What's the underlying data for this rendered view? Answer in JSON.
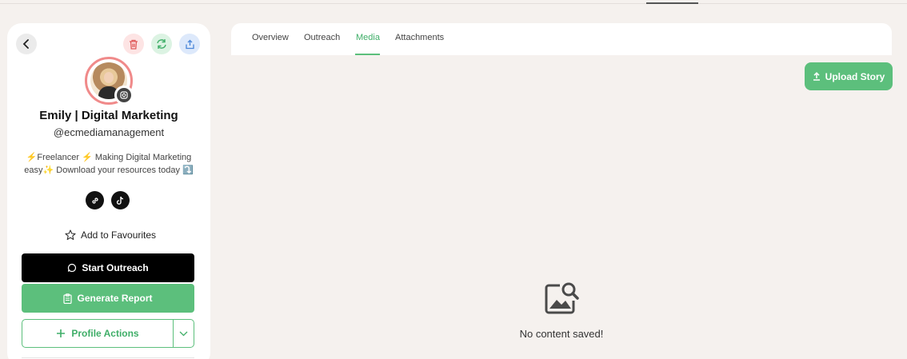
{
  "profile": {
    "name": "Emily | Digital Marketing",
    "handle": "@ecmediamanagement",
    "bio_line1": "⚡Freelancer ⚡ Making Digital Marketing",
    "bio_line2": "easy✨ Download your resources today ⤵️"
  },
  "sidebar": {
    "favourite_label": "Add to Favourites",
    "start_outreach_label": "Start Outreach",
    "generate_report_label": "Generate Report",
    "profile_actions_label": "Profile Actions"
  },
  "tabs": [
    {
      "label": "Overview",
      "active": false
    },
    {
      "label": "Outreach",
      "active": false
    },
    {
      "label": "Media",
      "active": true
    },
    {
      "label": "Attachments",
      "active": false
    }
  ],
  "media": {
    "upload_label": "Upload Story",
    "empty_text": "No content saved!"
  },
  "colors": {
    "accent_green": "#5cbf7c",
    "delete_red": "#e05a5a",
    "share_blue": "#4a86d8",
    "background": "#f5f1ee"
  },
  "icons": [
    "back-icon",
    "trash-icon",
    "refresh-icon",
    "share-icon",
    "instagram-icon",
    "link-icon",
    "tiktok-icon",
    "star-icon",
    "chat-icon",
    "clipboard-icon",
    "plus-icon",
    "chevron-down-icon",
    "upload-icon",
    "image-search-icon"
  ]
}
